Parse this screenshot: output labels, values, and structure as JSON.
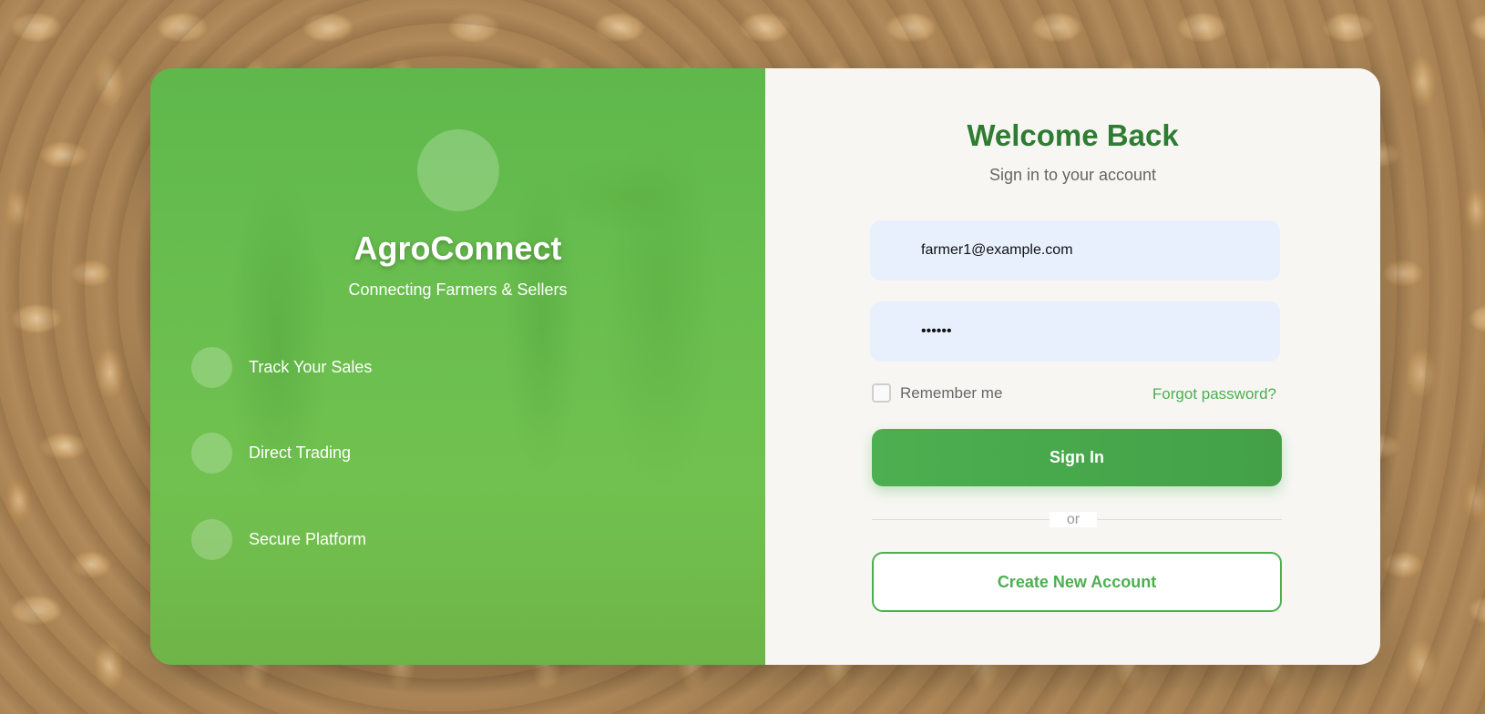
{
  "left_panel": {
    "brand": "AgroConnect",
    "tagline": "Connecting Farmers & Sellers",
    "features": [
      {
        "label": "Track Your Sales"
      },
      {
        "label": "Direct Trading"
      },
      {
        "label": "Secure Platform"
      }
    ]
  },
  "login": {
    "title": "Welcome Back",
    "subtitle": "Sign in to your account",
    "email_value": "farmer1@example.com",
    "password_value": "••••••",
    "remember_label": "Remember me",
    "forgot_label": "Forgot password?",
    "signin_label": "Sign In",
    "divider_label": "or",
    "create_label": "Create New Account"
  },
  "colors": {
    "primary_green": "#4caf50",
    "title_green": "#2e7d32",
    "input_bg": "#e8f0fe"
  }
}
